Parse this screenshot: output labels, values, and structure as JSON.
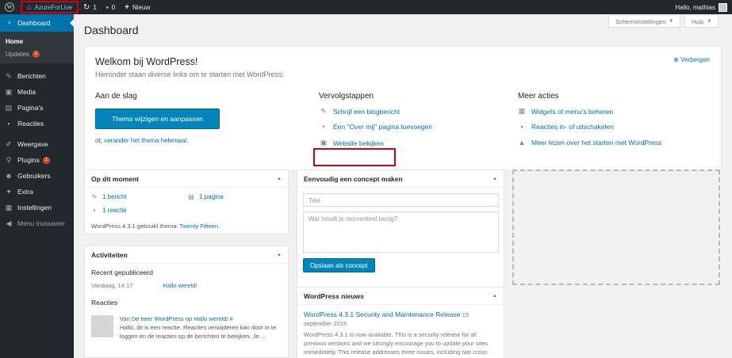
{
  "adminbar": {
    "site_name": "AzureForLive",
    "updates_count": "1",
    "comments_count": "0",
    "new_label": "Nieuw",
    "greeting": "Hallo, mathias"
  },
  "sidebar": {
    "dashboard": "Dashboard",
    "home": "Home",
    "updates": "Updates",
    "updates_badge": "1",
    "items": [
      {
        "label": "Berichten"
      },
      {
        "label": "Media"
      },
      {
        "label": "Pagina's"
      },
      {
        "label": "Reacties"
      },
      {
        "label": "Weergave"
      },
      {
        "label": "Plugins",
        "badge": "1"
      },
      {
        "label": "Gebruikers"
      },
      {
        "label": "Extra"
      },
      {
        "label": "Instellingen"
      }
    ],
    "collapse": "Menu invouwen"
  },
  "header": {
    "title": "Dashboard",
    "screen_options": "Scherminstellingen",
    "help": "Hulp"
  },
  "welcome": {
    "title": "Welkom bij WordPress!",
    "subtitle": "Hieronder staan diverse links om te starten met WordPress:",
    "dismiss": "Verbergen",
    "col1_heading": "Aan de slag",
    "theme_button": "Thema wijzigen en aanpassen",
    "or_prefix": "of, ",
    "or_link": "verander het thema helemaal",
    "or_suffix": ".",
    "col2_heading": "Vervolgstappen",
    "next_steps": [
      "Schrijf een blogbericht",
      "Een \"Over mij\" pagina toevoegen",
      "Website bekijken"
    ],
    "col3_heading": "Meer acties",
    "more_actions": [
      "Widgets of menu's beheren",
      "Reacties in- of uitschakelen",
      "Meer lezen over het starten met WordPress"
    ]
  },
  "at_a_glance": {
    "title": "Op dit moment",
    "posts": "1 bericht",
    "pages": "1 pagina",
    "comments": "1 reactie",
    "version_prefix": "WordPress 4.3.1 gebruikt thema: ",
    "theme": "Twenty Fifteen",
    "version_suffix": "."
  },
  "activity": {
    "title": "Activiteiten",
    "recent_heading": "Recent gepubliceerd",
    "recent_date": "Vandaag, 14:17",
    "recent_post": "Hallo wereld!",
    "comments_heading": "Reacties",
    "comment_from": "Van ",
    "comment_author": "De heer WordPress",
    "comment_on": " op ",
    "comment_post": "Hallo wereld! #",
    "comment_text": "Hallo, dit is een reactie. Reacties verwijderen kan door in te loggen en de reacties op de berichten te bekijken. Je ..."
  },
  "quick_draft": {
    "title": "Eenvoudig een concept maken",
    "title_placeholder": "Titel",
    "content_placeholder": "Wat houdt je momenteel bezig?",
    "save_button": "Opslaan als concept"
  },
  "news": {
    "title": "WordPress nieuws",
    "headline": "WordPress 4.3.1 Security and Maintenance Release",
    "date": "15 september 2015",
    "excerpt": "WordPress 4.3.1 is now available. This is a security release for all previous versions and we strongly encourage you to update your sites immediately. This release addresses three issues, including two cross-"
  },
  "colors": {
    "accent": "#0073aa",
    "adminbar_bg": "#23282d",
    "button": "#0085ba",
    "badge": "#d54e21",
    "highlight": "#d0021b"
  }
}
